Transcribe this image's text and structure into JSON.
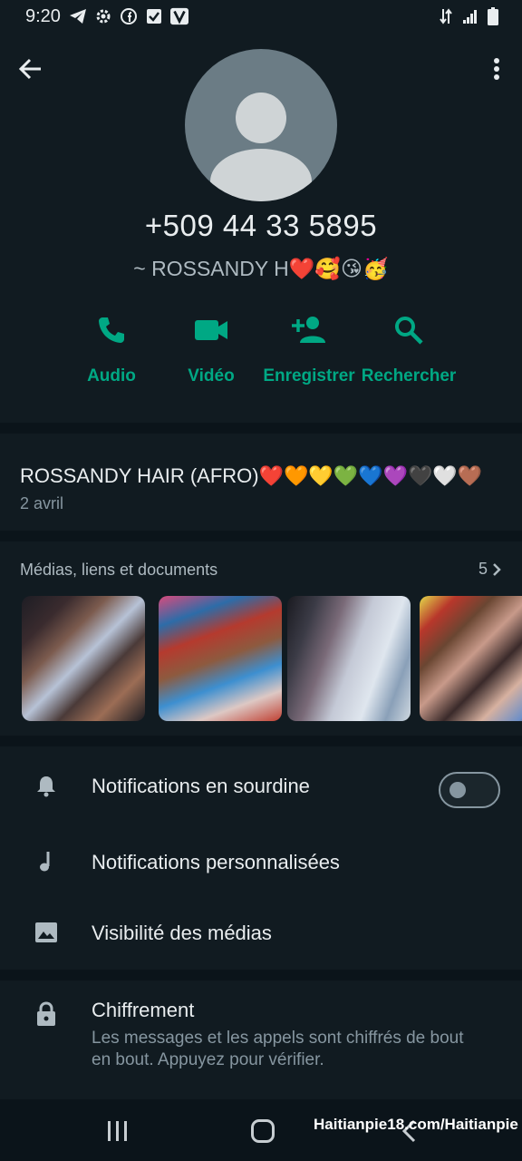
{
  "status_bar": {
    "time": "9:20",
    "left_icons": [
      "telegram-icon",
      "gear-icon",
      "facebook-icon",
      "check-box-icon",
      "v-app-icon"
    ],
    "right_icons": [
      "data-arrows-icon",
      "signal-icon",
      "battery-icon"
    ]
  },
  "header": {
    "back_icon": "arrow-left-icon",
    "menu_icon": "more-vert-icon",
    "avatar_icon": "default-avatar-icon",
    "phone": "+509 44 33 5895",
    "push_name": "~ ROSSANDY H❤️🥰😘🥳"
  },
  "actions": [
    {
      "label": "Audio",
      "icon": "phone-icon"
    },
    {
      "label": "Vidéo",
      "icon": "video-camera-icon"
    },
    {
      "label": "Enregistrer",
      "icon": "add-person-icon"
    },
    {
      "label": "Rechercher",
      "icon": "search-icon"
    }
  ],
  "about": {
    "status": "ROSSANDY HAIR (AFRO)❤️🧡💛💚💙💜🖤🤍🤎",
    "date": "2 avril"
  },
  "media": {
    "title": "Médias, liens et documents",
    "count": "5",
    "thumbnails": [
      "media-thumbnail-1",
      "media-thumbnail-2",
      "media-thumbnail-3",
      "media-thumbnail-4"
    ]
  },
  "settings": {
    "mute_label": "Notifications en sourdine",
    "mute_on": false,
    "custom_notifications_label": "Notifications personnalisées",
    "media_visibility_label": "Visibilité des médias"
  },
  "encryption": {
    "title": "Chiffrement",
    "description": "Les messages et les appels sont chiffrés de bout en bout. Appuyez pour vérifier."
  },
  "navbar": {
    "watermark": "Haitianpie18.com/Haitianpie"
  },
  "colors": {
    "background": "#111b21",
    "separator": "#0b141a",
    "accent": "#00a884",
    "primary_text": "#e9edef",
    "secondary_text": "#8696a0"
  }
}
